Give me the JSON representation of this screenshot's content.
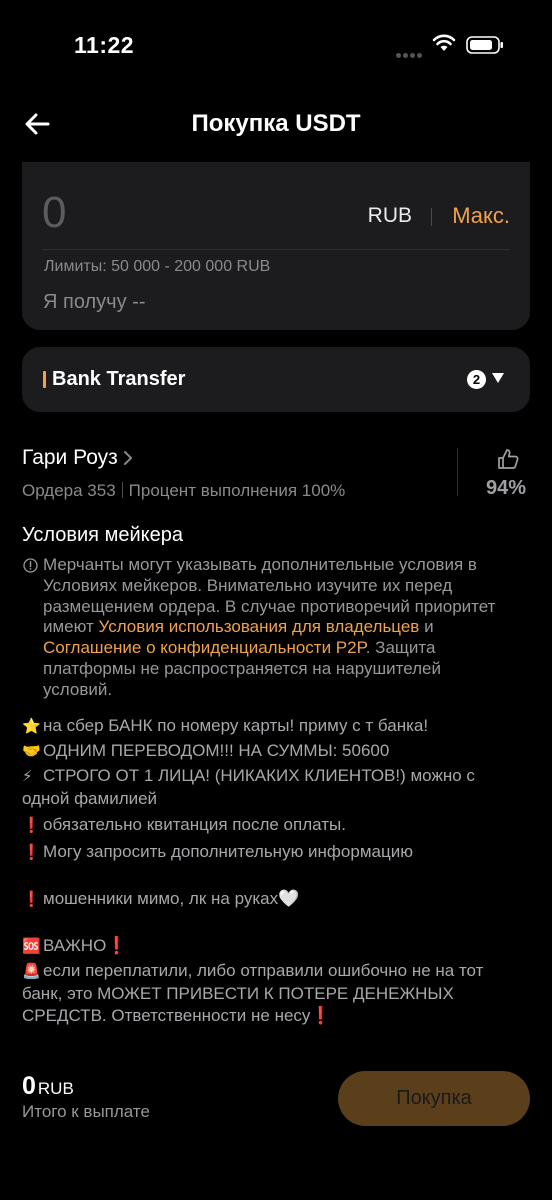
{
  "status_bar": {
    "time": "11:22"
  },
  "header": {
    "title": "Покупка USDT"
  },
  "amount_card": {
    "amount_value": "0",
    "currency": "RUB",
    "max_label": "Макс.",
    "limits": "Лимиты: 50 000 - 200 000 RUB",
    "receive": "Я получу --"
  },
  "payment_method": {
    "label": "Bank Transfer",
    "count": "2"
  },
  "merchant": {
    "name": "Гари Роуз",
    "orders": "Ордера 353",
    "completion": "Процент выполнения 100%",
    "like_percent": "94%"
  },
  "conditions": {
    "title": "Условия мейкера",
    "text_part1": "Мерчанты могут указывать дополнительные условия в Условиях мейкеров. Внимательно изучите их перед размещением ордера. В случае противоречий приоритет имеют ",
    "link1": "Условия использования для владельцев",
    "text_part2": " и ",
    "link2": "Соглашение о конфиденциальности P2P",
    "text_part3": ". Защита платформы не распространяется на нарушителей условий."
  },
  "terms": {
    "line1_emoji": "⭐",
    "line1": "на сбер БАНК по номеру карты! приму с т банка!",
    "line2_emoji": "🤝",
    "line2": "ОДНИМ ПЕРЕВОДОМ!!! НА СУММЫ: 50600",
    "line3_emoji": "⚡",
    "line3": "СТРОГО ОТ 1 ЛИЦА! (НИКАКИХ КЛИЕНТОВ!) можно с одной фамилией",
    "line4_emoji": "❗",
    "line4": "обязательно квитанция после оплаты.",
    "line5_emoji": "❗",
    "line5": "Могу запросить дополнительную информацию",
    "line6_emoji": "❗",
    "line6": "мошенники мимо, лк на руках🤍",
    "line7_emoji": "🆘",
    "line7": "ВАЖНО❗",
    "line8_emoji": "🚨",
    "line8": "если переплатили, либо отправили ошибочно не на тот банк, это МОЖЕТ ПРИВЕСТИ К ПОТЕРЕ ДЕНЕЖНЫХ СРЕДСТВ. Ответственности не несу❗"
  },
  "footer": {
    "total_amount": "0",
    "total_currency": "RUB",
    "total_label": "Итого к выплате",
    "buy_label": "Покупка"
  },
  "colors": {
    "accent": "#f0a24a",
    "background": "#000000",
    "card": "#1c1c1e",
    "button": "#5a3f1a"
  }
}
